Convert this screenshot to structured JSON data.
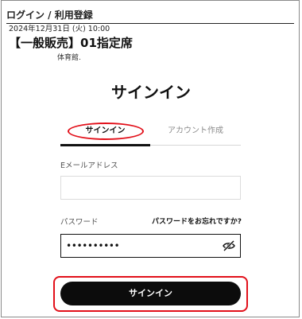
{
  "header": {
    "title": "ログイン / 利用登録"
  },
  "event": {
    "datetime": "2024年12月31日 (火) 10:00",
    "title": "【一般販売】01指定席",
    "venue": "体育館."
  },
  "form": {
    "heading": "サインイン",
    "tabs": [
      {
        "label": "サインイン"
      },
      {
        "label": "アカウント作成"
      }
    ],
    "email": {
      "label": "Eメールアドレス",
      "value": ""
    },
    "password": {
      "label": "パスワード",
      "value": "••••••••••"
    },
    "forgot_label": "パスワードをお忘れですか?",
    "submit_label": "サインイン"
  },
  "icons": {
    "password_toggle": "eye-off-icon"
  },
  "colors": {
    "highlight": "#e2101a",
    "button": "#0c0c0c"
  }
}
